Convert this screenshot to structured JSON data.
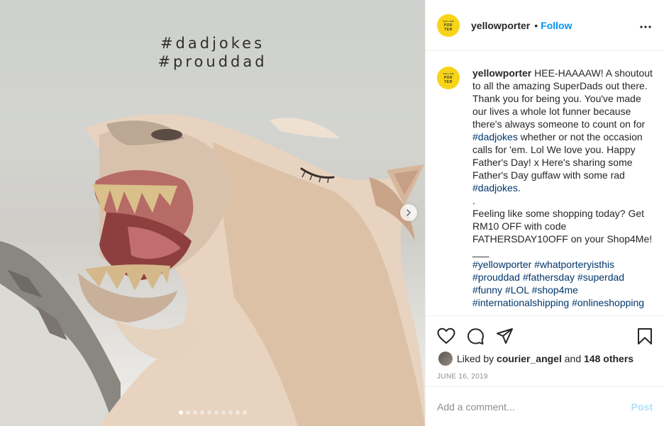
{
  "image": {
    "overlay_line1": "#dadjokes",
    "overlay_line2": "#prouddad",
    "carousel_count": 10,
    "carousel_active": 0
  },
  "header": {
    "avatar_text": [
      "YELLOW",
      "POR",
      "TER"
    ],
    "username": "yellowporter",
    "separator": "•",
    "follow_label": "Follow",
    "more_icon": "more-horizontal-icon"
  },
  "caption": {
    "username": "yellowporter",
    "text_part1": "HEE-HAAAAW! A shoutout to all the amazing SuperDads out there. Thank you for being you. You've made our lives a whole lot funner because there's always someone to count on for ",
    "tag1": "#dadjokes",
    "text_part2": " whether or not the occasion calls for 'em. Lol We love you. Happy Father's Day! x Here's sharing some Father's Day guffaw with some rad ",
    "tag2": "#dadjokes",
    "text_part3": ".\n.\nFeeling like some shopping today? Get RM10 OFF with code FATHERSDAY10OFF on your Shop4Me!\n___\n",
    "hashtags": [
      "#yellowporter",
      "#whatporteryisthis",
      "#prouddad",
      "#fathersday",
      "#superdad",
      "#funny",
      "#LOL",
      "#shop4me",
      "#internationalshipping",
      "#onlineshopping"
    ]
  },
  "actions": {
    "like_icon": "heart-icon",
    "comment_icon": "comment-icon",
    "share_icon": "paper-plane-icon",
    "save_icon": "bookmark-icon",
    "liked_by_prefix": "Liked by",
    "liked_by_user": "courier_angel",
    "liked_by_and": "and",
    "liked_by_others": "148 others",
    "date": "JUNE 16, 2019"
  },
  "comment_box": {
    "placeholder": "Add a comment...",
    "post_label": "Post"
  },
  "colors": {
    "link": "#0095f6",
    "hashtag": "#00376b",
    "avatar_bg": "#f7d417",
    "post_disabled": "#b2dffc"
  }
}
